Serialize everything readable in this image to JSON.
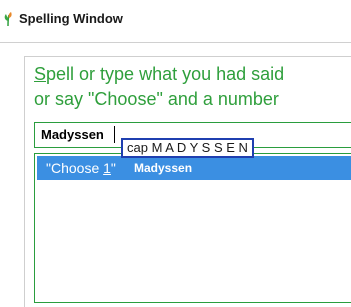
{
  "window": {
    "title": "Spelling Window",
    "accent_color": "#2f9f3c",
    "selection_color": "#3b8fe2",
    "tooltip_border_color": "#1f3fb0",
    "icon": "green-leaf-icon"
  },
  "instructions": {
    "line1_first_char": "S",
    "line1_rest": "pell or type what you had said",
    "line2": "or say \"Choose\" and a number"
  },
  "input": {
    "value": "Madyssen"
  },
  "tooltip": {
    "text": "cap M A D Y S S E N"
  },
  "list": {
    "items": [
      {
        "choose_prefix": "\"Choose ",
        "choose_number": "1",
        "choose_suffix": "\"",
        "value": "Madyssen"
      }
    ]
  }
}
